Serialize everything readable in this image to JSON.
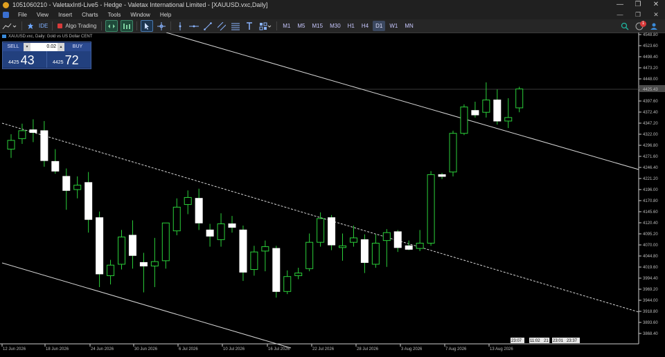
{
  "window": {
    "title": "1051060210 - ValetaxIntl-Live5 - Hedge - Valetax International Limited - [XAUUSD.vxc,Daily]",
    "controls": [
      "—",
      "❐",
      "✕"
    ]
  },
  "menu": {
    "items": [
      "File",
      "View",
      "Insert",
      "Charts",
      "Tools",
      "Window",
      "Help"
    ],
    "right_controls": [
      "—",
      "❐",
      "✕"
    ]
  },
  "toolbar": {
    "ide_label": "IDE",
    "algo_label": "Algo Trading",
    "timeframes": [
      "M1",
      "M5",
      "M15",
      "M30",
      "H1",
      "H4",
      "D1",
      "W1",
      "MN"
    ],
    "selected_timeframe": "D1",
    "notification_count": "1",
    "icons": [
      "new-chart-icon",
      "strategy-tester-icon",
      "algo-trading-icon",
      "one-click-trading-icon",
      "market-depth-icon",
      "cursor-icon",
      "crosshair-icon",
      "vertical-line-icon",
      "horizontal-line-icon",
      "trendline-icon",
      "equidistant-channel-icon",
      "fibonacci-icon",
      "text-icon",
      "shapes-icon",
      "search-icon",
      "notifications-icon",
      "account-icon"
    ]
  },
  "symbol": {
    "description": "XAUUSD.vxc, Daily:  Gold vs US Dollar CENT"
  },
  "trade_panel": {
    "sell_label": "SELL",
    "buy_label": "BUY",
    "volume": "0.02",
    "sell_price_prefix": "4425",
    "sell_price_main": "43",
    "buy_price_prefix": "4425",
    "buy_price_main": "72"
  },
  "chart_data": {
    "type": "candlestick",
    "symbol": "XAUUSD.vxc",
    "timeframe": "Daily",
    "price_labels": [
      "4548.80",
      "4523.60",
      "4498.40",
      "4473.20",
      "4448.00",
      "4422.80",
      "4397.60",
      "4372.40",
      "4347.20",
      "4322.00",
      "4296.80",
      "4271.60",
      "4246.40",
      "4221.20",
      "4196.00",
      "4170.80",
      "4145.60",
      "4120.40",
      "4095.20",
      "4070.00",
      "4044.80",
      "4019.60",
      "3994.40",
      "3969.20",
      "3944.00",
      "3918.80",
      "3893.60",
      "3868.40"
    ],
    "current_price": "4425.43",
    "time_labels": [
      "12 Jun 2026",
      "18 Jun 2026",
      "24 Jun 2026",
      "30 Jun 2026",
      "6 Jul 2026",
      "10 Jul 2026",
      "16 Jul 2026",
      "22 Jul 2026",
      "28 Jul 2026",
      "3 Aug 2026",
      "7 Aug 2026",
      "13 Aug 2026"
    ],
    "time_markers": [
      "23:07",
      "11:02",
      "21",
      "23:01",
      "23:37"
    ],
    "candles": [
      {
        "o": 4288,
        "h": 4322,
        "l": 4268,
        "c": 4308
      },
      {
        "o": 4312,
        "h": 4346,
        "l": 4300,
        "c": 4330
      },
      {
        "o": 4332,
        "h": 4356,
        "l": 4304,
        "c": 4326
      },
      {
        "o": 4330,
        "h": 4352,
        "l": 4248,
        "c": 4262
      },
      {
        "o": 4260,
        "h": 4288,
        "l": 4232,
        "c": 4238
      },
      {
        "o": 4226,
        "h": 4244,
        "l": 4150,
        "c": 4194
      },
      {
        "o": 4196,
        "h": 4226,
        "l": 4176,
        "c": 4206
      },
      {
        "o": 4212,
        "h": 4236,
        "l": 4098,
        "c": 4128
      },
      {
        "o": 4132,
        "h": 4146,
        "l": 3974,
        "c": 4004
      },
      {
        "o": 4000,
        "h": 4036,
        "l": 3980,
        "c": 4024
      },
      {
        "o": 4026,
        "h": 4104,
        "l": 4014,
        "c": 4088
      },
      {
        "o": 4092,
        "h": 4126,
        "l": 4016,
        "c": 4046
      },
      {
        "o": 4030,
        "h": 4052,
        "l": 3962,
        "c": 4022
      },
      {
        "o": 4022,
        "h": 4086,
        "l": 3974,
        "c": 4032
      },
      {
        "o": 4034,
        "h": 4104,
        "l": 4016,
        "c": 4120
      },
      {
        "o": 4102,
        "h": 4176,
        "l": 4092,
        "c": 4156
      },
      {
        "o": 4162,
        "h": 4194,
        "l": 4140,
        "c": 4178
      },
      {
        "o": 4176,
        "h": 4198,
        "l": 4104,
        "c": 4120
      },
      {
        "o": 4104,
        "h": 4118,
        "l": 4066,
        "c": 4090
      },
      {
        "o": 4082,
        "h": 4142,
        "l": 4066,
        "c": 4118
      },
      {
        "o": 4118,
        "h": 4136,
        "l": 4098,
        "c": 4110
      },
      {
        "o": 4104,
        "h": 4114,
        "l": 3988,
        "c": 4008
      },
      {
        "o": 4014,
        "h": 4068,
        "l": 4000,
        "c": 4054
      },
      {
        "o": 4056,
        "h": 4080,
        "l": 4010,
        "c": 4066
      },
      {
        "o": 4062,
        "h": 4068,
        "l": 3950,
        "c": 3964
      },
      {
        "o": 3964,
        "h": 4012,
        "l": 3958,
        "c": 3998
      },
      {
        "o": 4000,
        "h": 4018,
        "l": 3992,
        "c": 4006
      },
      {
        "o": 4016,
        "h": 4096,
        "l": 4010,
        "c": 4076
      },
      {
        "o": 4076,
        "h": 4144,
        "l": 4066,
        "c": 4130
      },
      {
        "o": 4132,
        "h": 4138,
        "l": 4058,
        "c": 4070
      },
      {
        "o": 4064,
        "h": 4096,
        "l": 4034,
        "c": 4068
      },
      {
        "o": 4076,
        "h": 4114,
        "l": 4066,
        "c": 4086
      },
      {
        "o": 4082,
        "h": 4094,
        "l": 4006,
        "c": 4030
      },
      {
        "o": 4026,
        "h": 4094,
        "l": 4018,
        "c": 4074
      },
      {
        "o": 4080,
        "h": 4106,
        "l": 4020,
        "c": 4098
      },
      {
        "o": 4100,
        "h": 4104,
        "l": 4054,
        "c": 4064
      },
      {
        "o": 4068,
        "h": 4080,
        "l": 4058,
        "c": 4060
      },
      {
        "o": 4062,
        "h": 4104,
        "l": 4056,
        "c": 4074
      },
      {
        "o": 4074,
        "h": 4238,
        "l": 4068,
        "c": 4230
      },
      {
        "o": 4230,
        "h": 4234,
        "l": 4220,
        "c": 4226
      },
      {
        "o": 4236,
        "h": 4330,
        "l": 4226,
        "c": 4324
      },
      {
        "o": 4324,
        "h": 4390,
        "l": 4320,
        "c": 4384
      },
      {
        "o": 4376,
        "h": 4396,
        "l": 4360,
        "c": 4366
      },
      {
        "o": 4372,
        "h": 4440,
        "l": 4360,
        "c": 4400
      },
      {
        "o": 4400,
        "h": 4424,
        "l": 4344,
        "c": 4352
      },
      {
        "o": 4352,
        "h": 4404,
        "l": 4336,
        "c": 4360
      },
      {
        "o": 4382,
        "h": 4430,
        "l": 4372,
        "c": 4425
      }
    ]
  }
}
